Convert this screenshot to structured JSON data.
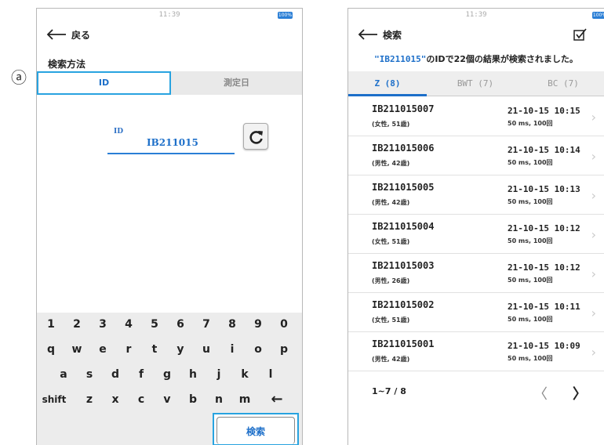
{
  "annotation": {
    "marker": "ⓐ"
  },
  "left_screen": {
    "status": {
      "time": "11:39",
      "battery": "100%"
    },
    "nav": {
      "back_label": "戻る"
    },
    "section_title": "検索方法",
    "method_tabs": [
      {
        "label": "ID",
        "active": true
      },
      {
        "label": "測定日",
        "active": false
      }
    ],
    "id_field": {
      "label": "ID",
      "value": "IB211015"
    },
    "refresh_icon": "refresh-icon",
    "keyboard": {
      "row1": [
        "1",
        "2",
        "3",
        "4",
        "5",
        "6",
        "7",
        "8",
        "9",
        "0"
      ],
      "row2": [
        "q",
        "w",
        "e",
        "r",
        "t",
        "y",
        "u",
        "i",
        "o",
        "p"
      ],
      "row3": [
        "a",
        "s",
        "d",
        "f",
        "g",
        "h",
        "j",
        "k",
        "l"
      ],
      "row4": {
        "shift": "shift",
        "keys": [
          "z",
          "x",
          "c",
          "v",
          "b",
          "n",
          "m"
        ],
        "backspace": "←"
      },
      "search_label": "検索"
    }
  },
  "right_screen": {
    "status": {
      "time": "11:39",
      "battery": "100%"
    },
    "nav": {
      "back_label": "検索"
    },
    "summary": {
      "query": "\"IB211015\"",
      "rest": "のIDで22個の結果が検索されました。"
    },
    "tabs": [
      {
        "label": "Z (8)",
        "active": true
      },
      {
        "label": "BWT (7)",
        "active": false
      },
      {
        "label": "BC (7)",
        "active": false
      }
    ],
    "results": [
      {
        "id": "IB211015007",
        "sub": "(女性, 51歳)",
        "time": "21-10-15 10:15",
        "meta": "50 ms, 100回"
      },
      {
        "id": "IB211015006",
        "sub": "(男性, 42歳)",
        "time": "21-10-15 10:14",
        "meta": "50 ms, 100回"
      },
      {
        "id": "IB211015005",
        "sub": "(男性, 42歳)",
        "time": "21-10-15 10:13",
        "meta": "50 ms, 100回"
      },
      {
        "id": "IB211015004",
        "sub": "(女性, 51歳)",
        "time": "21-10-15 10:12",
        "meta": "50 ms, 100回"
      },
      {
        "id": "IB211015003",
        "sub": "(男性, 26歳)",
        "time": "21-10-15 10:12",
        "meta": "50 ms, 100回"
      },
      {
        "id": "IB211015002",
        "sub": "(女性, 51歳)",
        "time": "21-10-15 10:11",
        "meta": "50 ms, 100回"
      },
      {
        "id": "IB211015001",
        "sub": "(男性, 42歳)",
        "time": "21-10-15 10:09",
        "meta": "50 ms, 100回"
      }
    ],
    "chevron": "›",
    "pager": {
      "range": "1~7 / 8",
      "prev": "〈",
      "next": "〉"
    }
  },
  "colors": {
    "accent": "#1d6fc9",
    "highlight_border": "#28a3e0"
  }
}
